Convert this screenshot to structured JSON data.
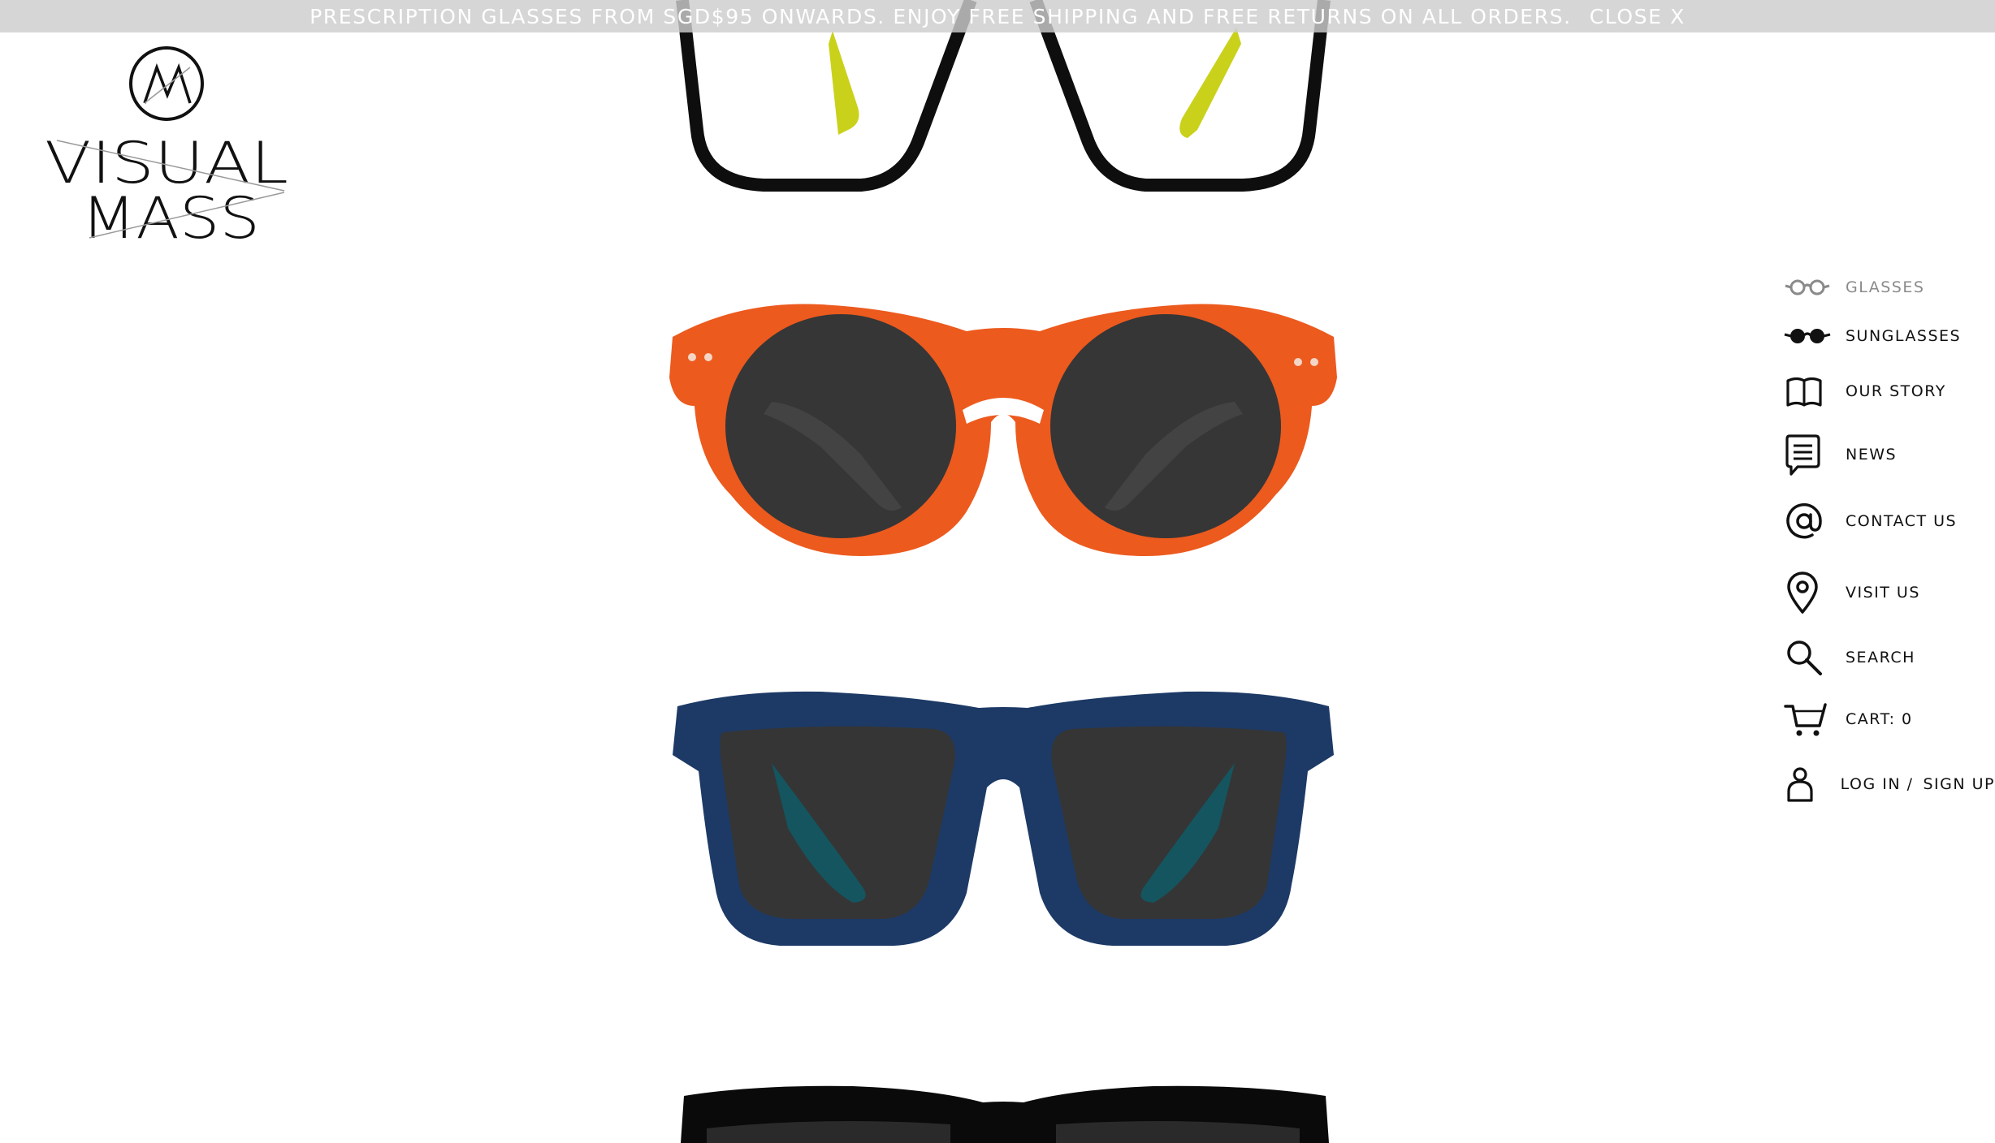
{
  "banner": {
    "message": "PRESCRIPTION GLASSES FROM SGD$95 ONWARDS. ENJOY FREE SHIPPING AND FREE RETURNS ON ALL ORDERS.",
    "close_label": "CLOSE X"
  },
  "logo": {
    "line1": "VISUAL",
    "line2": "MASS"
  },
  "nav": {
    "glasses": "GLASSES",
    "sunglasses": "SUNGLASSES",
    "our_story": "OUR STORY",
    "news": "NEWS",
    "contact_us": "CONTACT US",
    "visit_us": "VISIT US",
    "search": "SEARCH",
    "cart": "CART: 0",
    "log_in": "LOG IN /",
    "sign_up": "SIGN UP"
  },
  "products": [
    {
      "name": "black-yellow-optical-frame",
      "colors": {
        "frame": "#0e0e0e",
        "temple": "#c9d11a"
      }
    },
    {
      "name": "orange-round-sunglasses",
      "colors": {
        "frame": "#ec5a1e",
        "lens": "#363636"
      }
    },
    {
      "name": "navy-square-sunglasses",
      "colors": {
        "frame": "#1d3a66",
        "lens": "#353535",
        "temple": "#0f5a66"
      }
    },
    {
      "name": "black-frame-partial",
      "colors": {
        "frame": "#0a0a0a"
      }
    }
  ],
  "colors": {
    "banner_bg": "#cdcdcd",
    "nav_text": "#111111",
    "nav_muted": "#8a8a8a"
  }
}
